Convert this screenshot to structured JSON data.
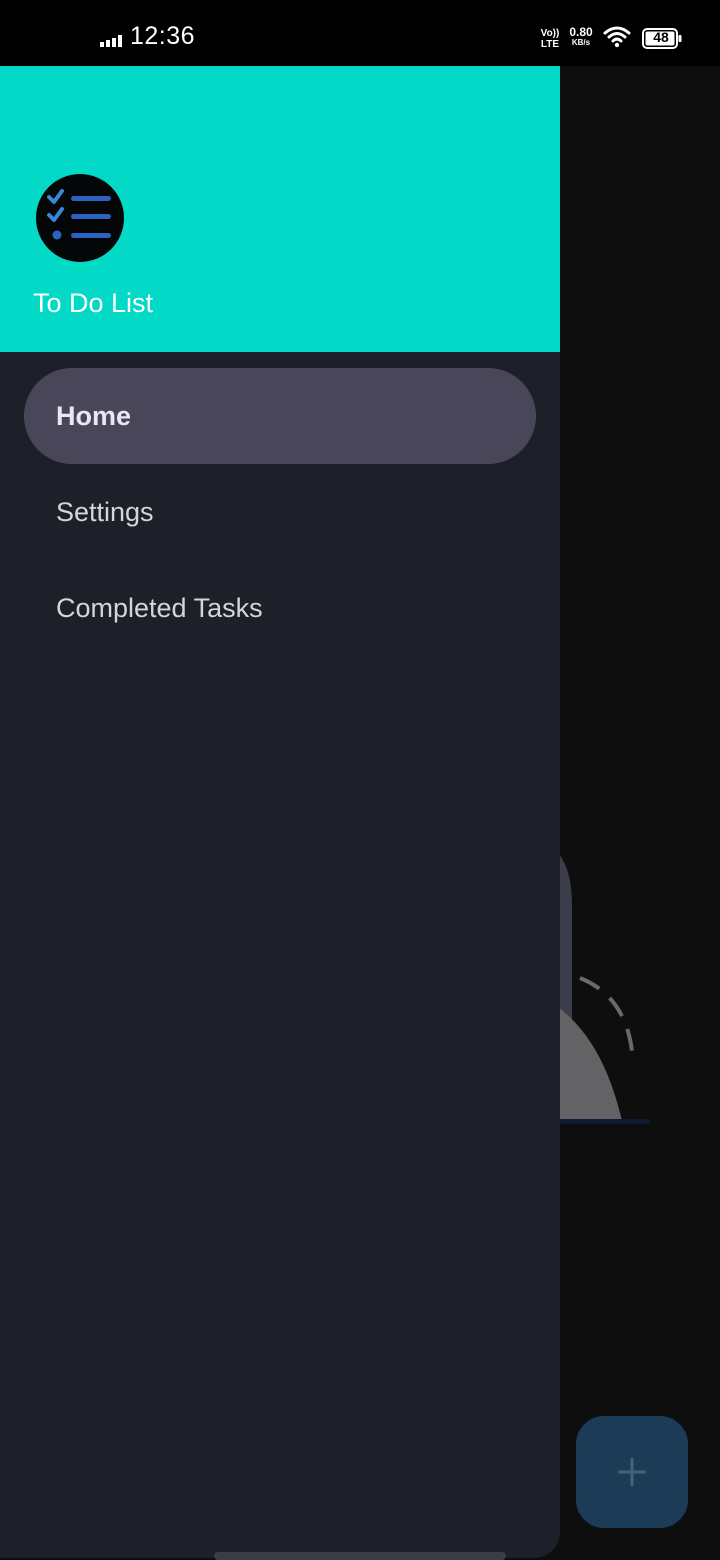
{
  "status_bar": {
    "time": "12:36",
    "net_speed_value": "0.80",
    "net_speed_unit": "KB/s",
    "battery_level": "48",
    "icons": [
      "signal-icon",
      "volte-icon",
      "wifi-icon",
      "battery-icon"
    ]
  },
  "drawer": {
    "header": {
      "app_title": "To Do List",
      "logo_icon": "checklist-icon",
      "background_color": "#02d9c6"
    },
    "items": [
      {
        "label": "Home",
        "active": true
      },
      {
        "label": "Settings",
        "active": false
      },
      {
        "label": "Completed Tasks",
        "active": false
      }
    ],
    "background_color": "#1d2029",
    "active_item_color": "#4a4659"
  },
  "background_app": {
    "fab_icon": "plus-icon",
    "fab_color": "#1b3b57"
  }
}
